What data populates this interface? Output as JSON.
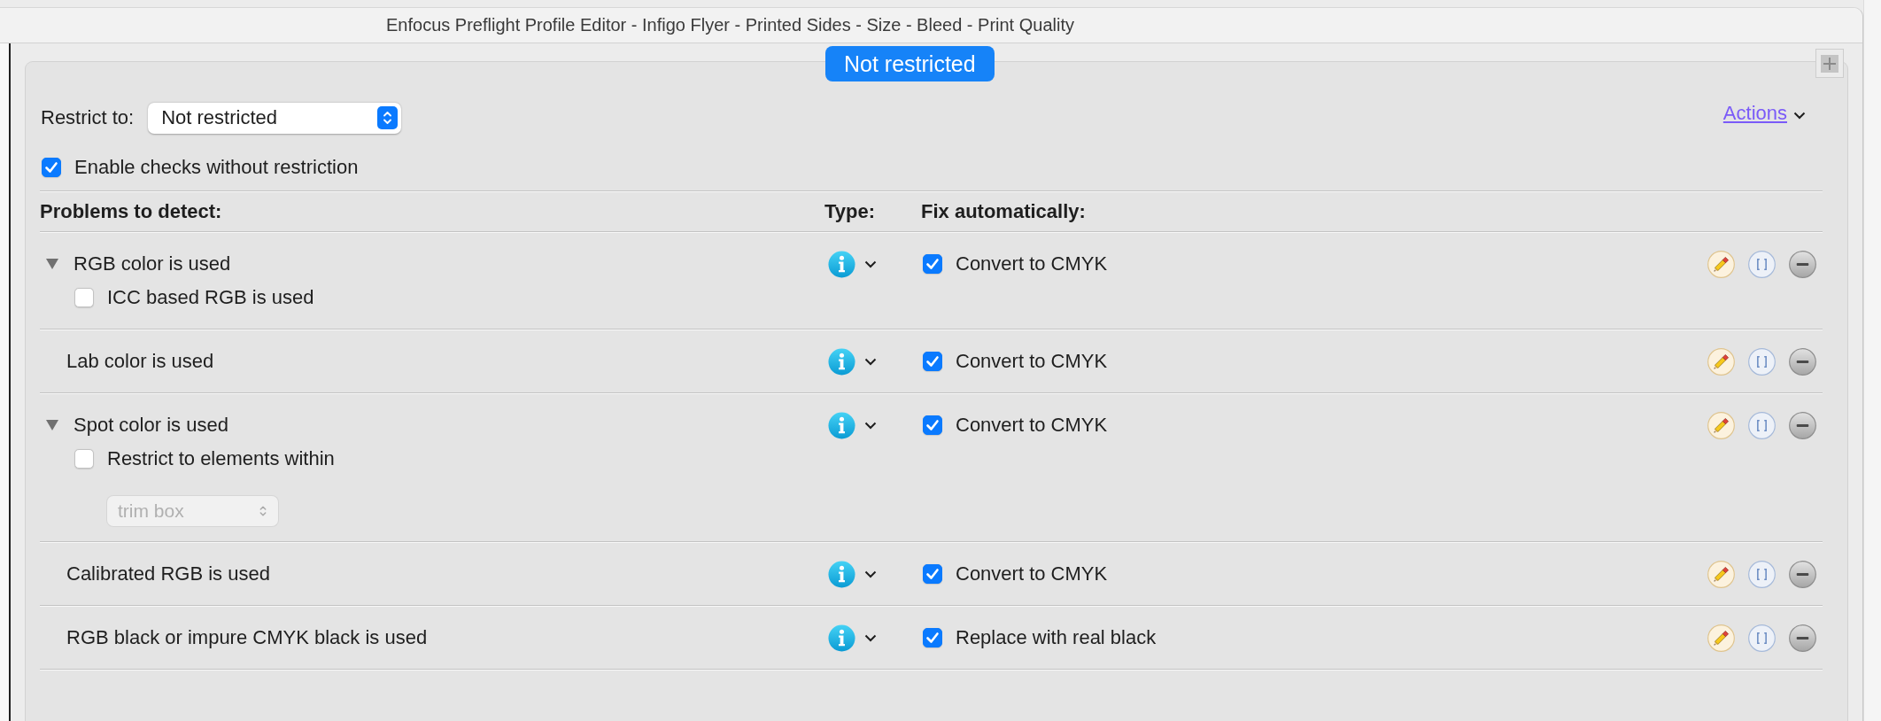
{
  "window": {
    "title": "Enfocus Preflight Profile Editor - Infigo Flyer - Printed Sides - Size - Bleed - Print Quality"
  },
  "panel": {
    "badge": "Not restricted",
    "restrict": {
      "label": "Restrict to:",
      "value": "Not restricted"
    },
    "actions_link": "Actions",
    "enable_checks": {
      "label": "Enable checks without restriction",
      "checked": true
    }
  },
  "table": {
    "columns": [
      "Problems to detect:",
      "Type:",
      "Fix automatically:"
    ],
    "rows": [
      {
        "problem": "RGB color is used",
        "expanded": true,
        "options": [
          {
            "kind": "checkbox",
            "label": "ICC based RGB is used",
            "checked": false
          }
        ],
        "fix": {
          "label": "Convert to CMYK",
          "checked": true
        }
      },
      {
        "problem": "Lab color is used",
        "fix": {
          "label": "Convert to CMYK",
          "checked": true
        }
      },
      {
        "problem": "Spot color is used",
        "expanded": true,
        "options": [
          {
            "kind": "checkbox",
            "label": "Restrict to elements within",
            "checked": false
          },
          {
            "kind": "dropdown",
            "value": "trim box",
            "disabled": true
          }
        ],
        "fix": {
          "label": "Convert to CMYK",
          "checked": true
        }
      },
      {
        "problem": "Calibrated RGB is used",
        "fix": {
          "label": "Convert to CMYK",
          "checked": true
        }
      },
      {
        "problem": "RGB black or impure CMYK black is used",
        "fix": {
          "label": "Replace with real black",
          "checked": true
        }
      }
    ]
  }
}
